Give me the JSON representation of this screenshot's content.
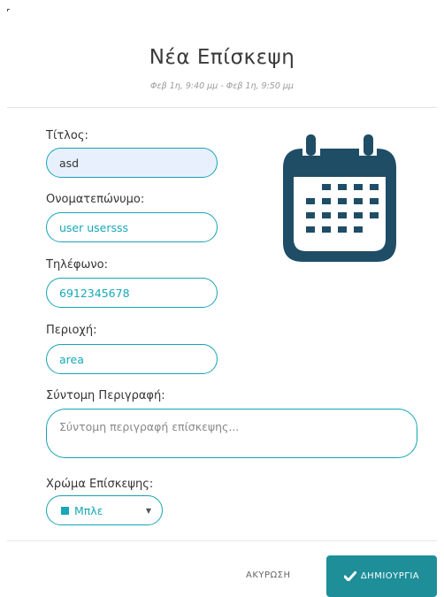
{
  "modal": {
    "title": "Νέα Επίσκεψη",
    "subtitle": "Φεβ 1η, 9:40 μμ - Φεβ 1η, 9:50 μμ"
  },
  "form": {
    "title_label": "Τίτλος:",
    "title_value": "asd",
    "name_label": "Ονοματεπώνυμο:",
    "name_value": "user usersss",
    "phone_label": "Τηλέφωνο:",
    "phone_value": "6912345678",
    "area_label": "Περιοχή:",
    "area_value": "area",
    "description_label": "Σύντομη Περιγραφή:",
    "description_placeholder": "Σύντομη περιγραφή επίσκεψης...",
    "color_label": "Χρώμα Επίσκεψης:",
    "color_value": "Μπλε"
  },
  "buttons": {
    "cancel": "ΑΚΥΡΩΣΗ",
    "create": "ΔΗΜΙΟΥΡΓΙΑ"
  },
  "icons": {
    "calendar": "calendar-icon",
    "check": "check-icon",
    "caret": "caret-down-icon"
  },
  "colors": {
    "accent": "#16a3b4",
    "calendar": "#1f4d66",
    "primary_button": "#1e8e99",
    "filled_input": "#e8f0fe"
  }
}
